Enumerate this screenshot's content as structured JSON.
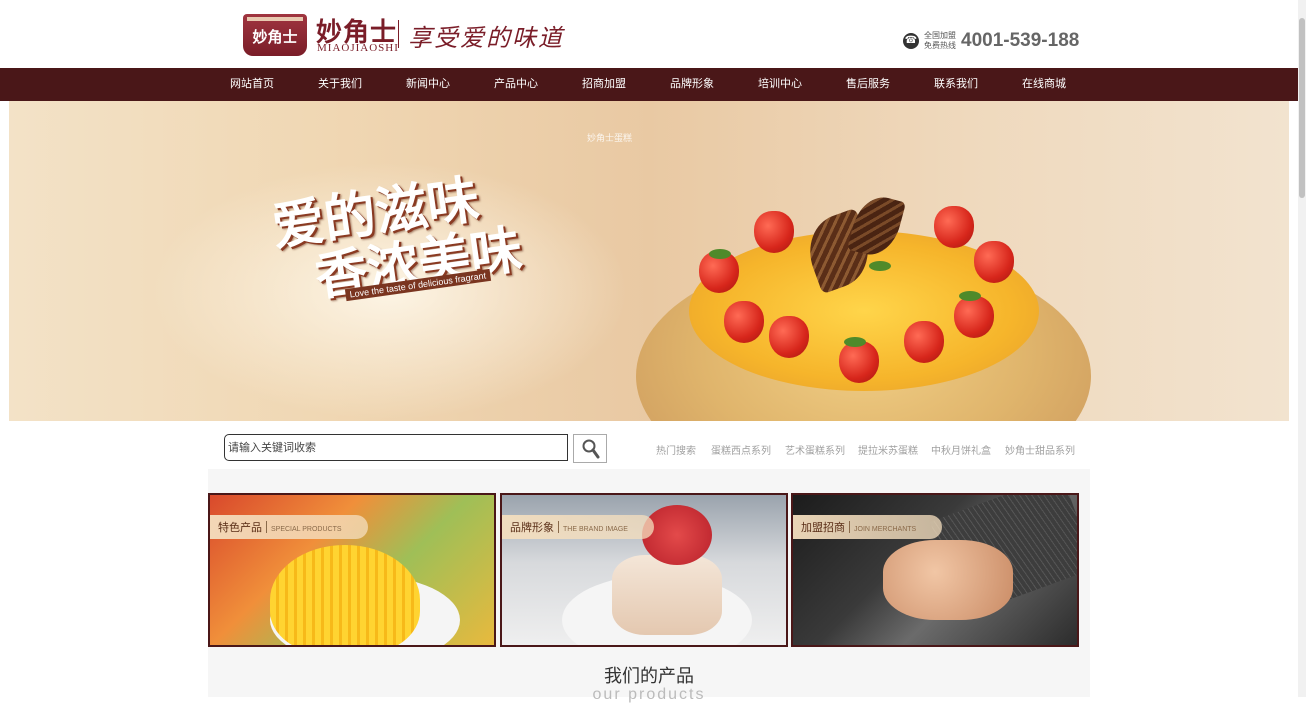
{
  "header": {
    "logo_emblem_text": "妙角士",
    "brand_cn": "妙角士",
    "brand_en": "MIAOJIAOSHI",
    "slogan": "享受爱的味道",
    "hotline_label_line1": "全国加盟",
    "hotline_label_line2": "免费热线",
    "hotline_number": "4001-539-188"
  },
  "nav": {
    "items": [
      {
        "label": "网站首页"
      },
      {
        "label": "关于我们"
      },
      {
        "label": "新闻中心"
      },
      {
        "label": "产品中心"
      },
      {
        "label": "招商加盟"
      },
      {
        "label": "品牌形象"
      },
      {
        "label": "培训中心"
      },
      {
        "label": "售后服务"
      },
      {
        "label": "联系我们"
      },
      {
        "label": "在线商城"
      }
    ]
  },
  "banner": {
    "headline_line1": "爱的滋味",
    "headline_line2": "香浓美味",
    "tagline": "Love the taste of delicious fragrant",
    "faint_text": "妙角士蛋糕"
  },
  "search": {
    "placeholder": "请输入关键词收索",
    "hot_label": "热门搜索",
    "hot_items": [
      "蛋糕西点系列",
      "艺术蛋糕系列",
      "提拉米苏蛋糕",
      "中秋月饼礼盒",
      "妙角士甜品系列"
    ]
  },
  "features": [
    {
      "label_cn": "特色产品",
      "label_en": "SPECIAL PRODUCTS"
    },
    {
      "label_cn": "品牌形象",
      "label_en": "THE BRAND IMAGE"
    },
    {
      "label_cn": "加盟招商",
      "label_en": "JOIN MERCHANTS"
    }
  ],
  "products_section": {
    "title": "我们的产品",
    "subtitle": "our products"
  },
  "colors": {
    "nav_bg": "#4a1718",
    "brand": "#7a1d28"
  }
}
